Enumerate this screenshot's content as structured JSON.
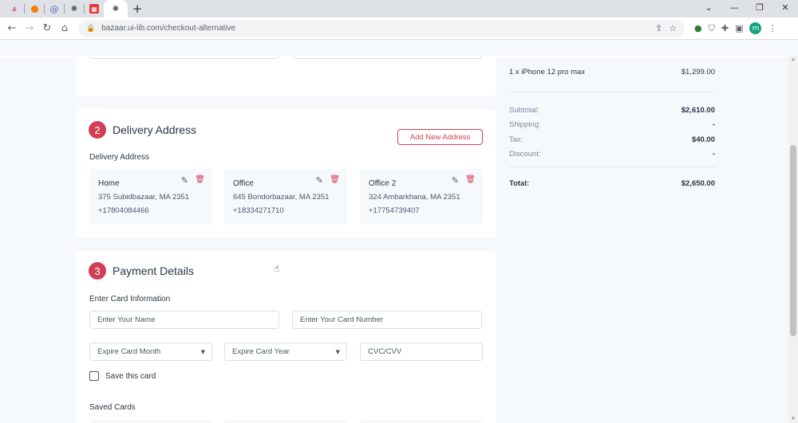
{
  "browser": {
    "tabs": [
      {
        "icon": "triangle-logo-icon",
        "color": "#c2185b"
      },
      {
        "icon": "orange-logo-icon",
        "color": "#f57c00"
      },
      {
        "icon": "at-sign-icon",
        "color": "#5c6bc0"
      },
      {
        "icon": "chatgpt-icon",
        "color": "#555555"
      },
      {
        "icon": "red-grid-icon",
        "color": "#e53935"
      },
      {
        "icon": "chatgpt-icon",
        "color": "#555555"
      }
    ],
    "url": "bazaar.ui-lib.com/checkout-alternative",
    "profile_initial": "m"
  },
  "delivery": {
    "step": "2",
    "title": "Delivery Address",
    "add_button": "Add New Address",
    "label": "Delivery Address",
    "addresses": [
      {
        "title": "Home",
        "street": "375 Subidbazaar, MA 2351",
        "phone": "+17804084466"
      },
      {
        "title": "Office",
        "street": "645 Bondorbazaar, MA 2351",
        "phone": "+18334271710"
      },
      {
        "title": "Office 2",
        "street": "324 Ambarkhana, MA 2351",
        "phone": "+17754739407"
      }
    ]
  },
  "payment": {
    "step": "3",
    "title": "Payment Details",
    "label": "Enter Card Information",
    "name_placeholder": "Enter Your Name",
    "number_placeholder": "Enter Your Card Number",
    "month_select": "Expire Card Month",
    "year_select": "Expire Card Year",
    "cvc_placeholder": "CVC/CVV",
    "save_card": "Save this card",
    "saved_cards": "Saved Cards"
  },
  "summary": {
    "item": "1 x iPhone 12 pro max",
    "item_price": "$1,299.00",
    "subtotal_label": "Subtotal:",
    "subtotal": "$2,610.00",
    "shipping_label": "Shipping:",
    "shipping": "-",
    "tax_label": "Tax:",
    "tax": "$40.00",
    "discount_label": "Discount:",
    "discount": "-",
    "total_label": "Total:",
    "total": "$2,650.00"
  },
  "colors": {
    "accent": "#d23f57",
    "page_bg": "#f6f9fc",
    "text": "#2b3445"
  }
}
